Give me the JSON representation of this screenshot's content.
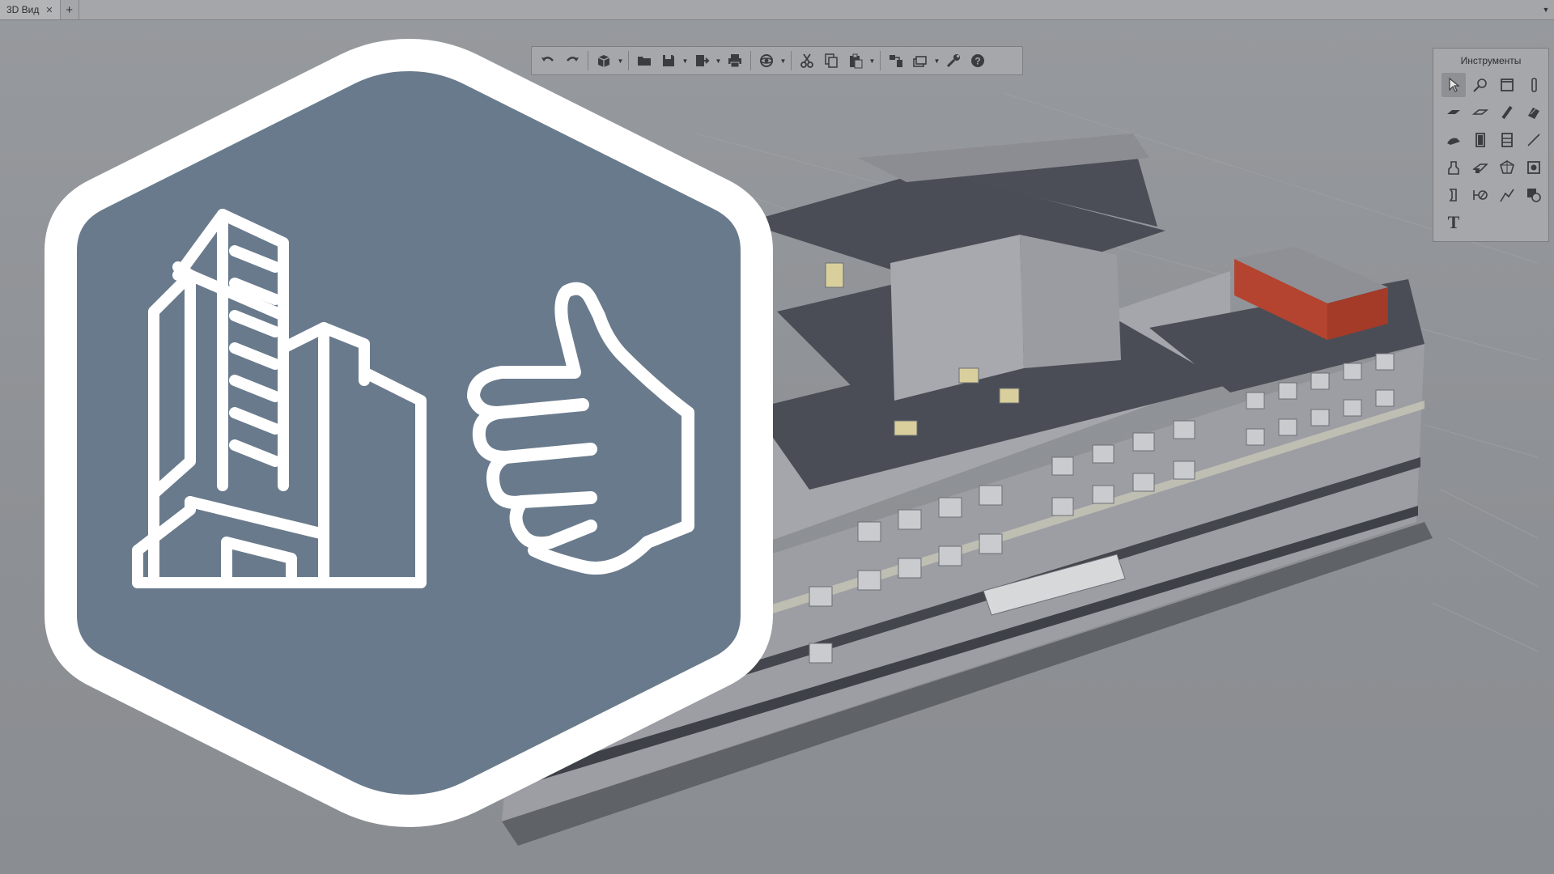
{
  "tabs": [
    {
      "label": "3D Вид",
      "close_icon": "close-icon"
    }
  ],
  "add_tab_icon": "plus-icon",
  "tab_menu_icon": "chevron-down-icon",
  "toolbar": {
    "buttons": [
      {
        "icon": "undo-icon"
      },
      {
        "icon": "redo-icon"
      },
      {
        "icon": "3d-view-icon",
        "dropdown": true
      },
      {
        "icon": "open-folder-icon"
      },
      {
        "icon": "save-icon",
        "dropdown": true
      },
      {
        "icon": "export-icon",
        "dropdown": true
      },
      {
        "icon": "print-icon"
      },
      {
        "icon": "orbit-icon",
        "dropdown": true
      },
      {
        "icon": "cut-icon"
      },
      {
        "icon": "copy-icon"
      },
      {
        "icon": "paste-icon",
        "dropdown": true
      },
      {
        "icon": "align-icon"
      },
      {
        "icon": "layers-icon",
        "dropdown": true
      },
      {
        "icon": "settings-wrench-icon"
      },
      {
        "icon": "help-icon"
      }
    ]
  },
  "palette": {
    "title": "Инструменты",
    "text_tool_glyph": "T"
  },
  "colors": {
    "logo_fill": "#697a8c",
    "logo_stroke": "#ffffff",
    "roof": "#4a4d55",
    "accent_red": "#b4442f",
    "accent_yellow": "#d8cf9c"
  }
}
